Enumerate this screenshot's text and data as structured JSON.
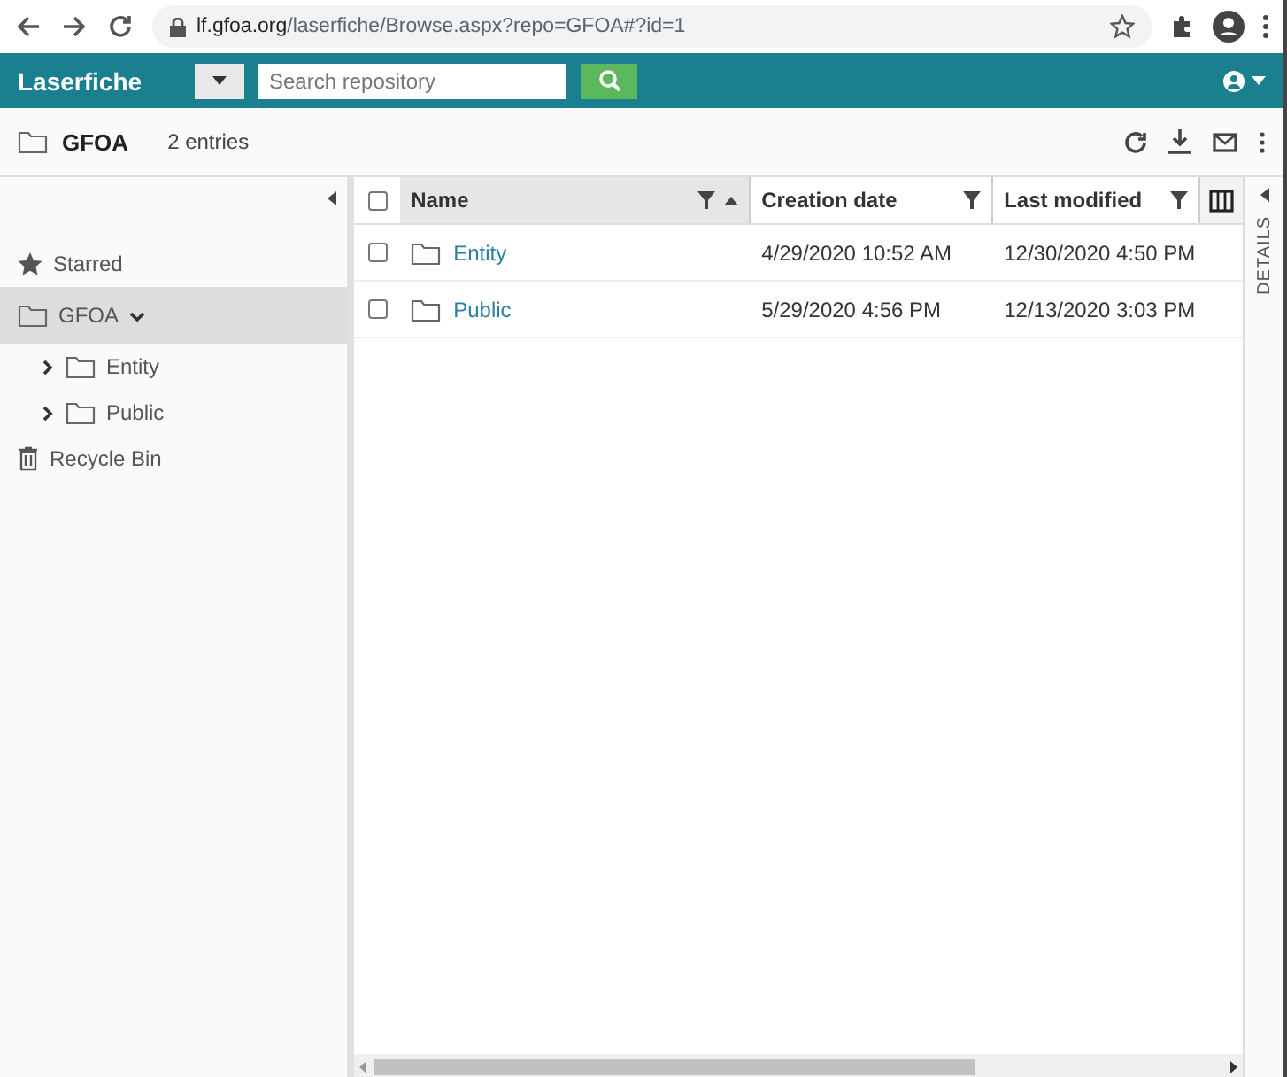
{
  "browser": {
    "url_host": "lf.gfoa.org",
    "url_path": "/laserfiche/Browse.aspx?repo=GFOA#?id=1"
  },
  "header": {
    "logo": "Laserfiche",
    "search": {
      "placeholder": "Search repository"
    }
  },
  "toolbar": {
    "title": "GFOA",
    "count": "2 entries"
  },
  "sidebar": {
    "items": [
      {
        "kind": "starred",
        "label": "Starred",
        "selected": false
      },
      {
        "kind": "folder",
        "label": "GFOA",
        "selected": true,
        "expanded": true,
        "children": [
          {
            "kind": "folder",
            "label": "Entity",
            "selected": false,
            "expanded": false
          },
          {
            "kind": "folder",
            "label": "Public",
            "selected": false,
            "expanded": false
          }
        ]
      },
      {
        "kind": "trash",
        "label": "Recycle Bin",
        "selected": false
      }
    ]
  },
  "table": {
    "select_all_checked": false,
    "columns": [
      {
        "label": "Name",
        "sorted": true
      },
      {
        "label": "Creation date",
        "sorted": false
      },
      {
        "label": "Last modified",
        "sorted": false
      }
    ],
    "rows": [
      {
        "name": "Entity",
        "created": "4/29/2020 10:52 AM",
        "modified": "12/30/2020 4:50 PM",
        "checked": false
      },
      {
        "name": "Public",
        "created": "5/29/2020 4:56 PM",
        "modified": "12/13/2020 3:03 PM",
        "checked": false
      }
    ]
  },
  "details_tab": "DETAILS"
}
